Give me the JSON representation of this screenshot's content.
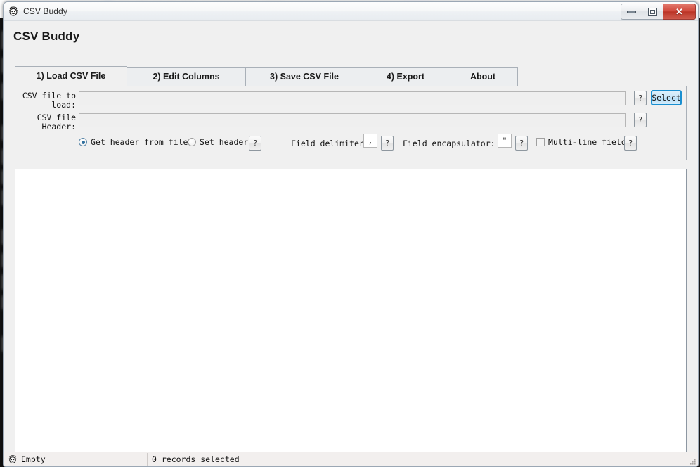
{
  "window": {
    "title": "CSV Buddy",
    "icon": "smiley-face-icon",
    "buttons": {
      "minimize": "minimize-icon",
      "restore": "restore-icon",
      "close": "✕"
    }
  },
  "app": {
    "heading": "CSV Buddy"
  },
  "tabs": [
    {
      "label": "1) Load CSV File",
      "active": true
    },
    {
      "label": "2) Edit Columns",
      "active": false
    },
    {
      "label": "3) Save CSV File",
      "active": false
    },
    {
      "label": "4) Export",
      "active": false
    },
    {
      "label": "About",
      "active": false
    }
  ],
  "load_tab": {
    "file_label": "CSV file to\nload:",
    "file_value": "",
    "file_placeholder": "",
    "file_help": "?",
    "select_button": "Select",
    "header_label": "CSV file\nHeader:",
    "header_value": "",
    "header_placeholder": "",
    "header_help": "?",
    "radio_get_header": "Get header from  file",
    "radio_set_header": "Set header",
    "radio_help": "?",
    "delimiter_label": "Field delimiter:",
    "delimiter_value": ",",
    "delimiter_help": "?",
    "encapsulator_label": "Field encapsulator:",
    "encapsulator_value": "\"",
    "encapsulator_help": "?",
    "multiline_label": "Multi-line fields",
    "multiline_checked": false,
    "multiline_help": "?",
    "header_source_selected": "get_from_file"
  },
  "grid": {
    "rows": [],
    "empty": true
  },
  "statusbar": {
    "state_icon": "smiley-face-icon",
    "state_text": "Empty",
    "records_text": "0 records selected"
  },
  "colors": {
    "window_bg": "#f0f0f0",
    "content_bg": "#ffffff",
    "accent_focus": "#1a8fd0",
    "close_button": "#bb3426",
    "border": "#a9b0b8",
    "status_bg": "#f2efee"
  }
}
